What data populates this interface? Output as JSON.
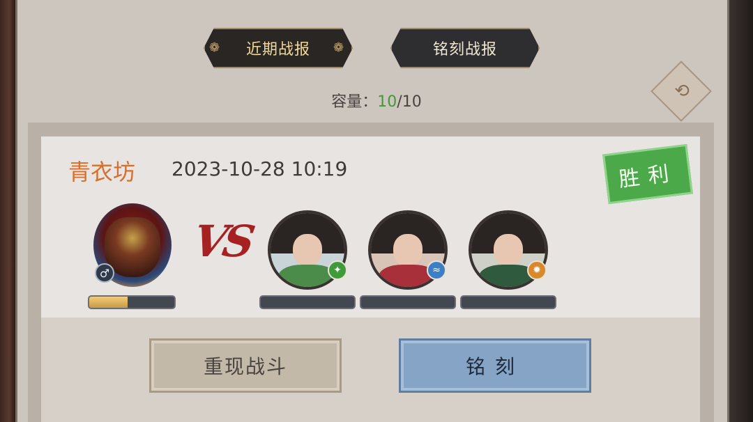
{
  "tabs": [
    {
      "label": "近期战报",
      "active": true
    },
    {
      "label": "铭刻战报",
      "active": false
    }
  ],
  "capacity": {
    "label": "容量：",
    "current": "10",
    "separator": "/",
    "max": "10"
  },
  "refresh_icon": "refresh-arrows-icon",
  "battle": {
    "team": "青衣坊",
    "time": "2023-10-28 10:19",
    "result": "胜利",
    "vs": "VS",
    "player": {
      "gender_symbol": "♂",
      "hp_fraction": 0.45
    },
    "enemies": [
      {
        "element": "wind",
        "element_color": "#3e9b3a",
        "hp_fraction": 0,
        "outfit_color": "#4c8c4a"
      },
      {
        "element": "water",
        "element_color": "#3d7fc4",
        "hp_fraction": 0,
        "outfit_color": "#a8303a"
      },
      {
        "element": "fire",
        "element_color": "#d9882a",
        "hp_fraction": 0,
        "outfit_color": "#2f5a3e"
      }
    ]
  },
  "actions": {
    "replay_label": "重现战斗",
    "engrave_label": "铭刻"
  },
  "colors": {
    "accent_green": "#3f9a37",
    "team_orange": "#d6702c",
    "victory_green": "#4ca94a"
  }
}
